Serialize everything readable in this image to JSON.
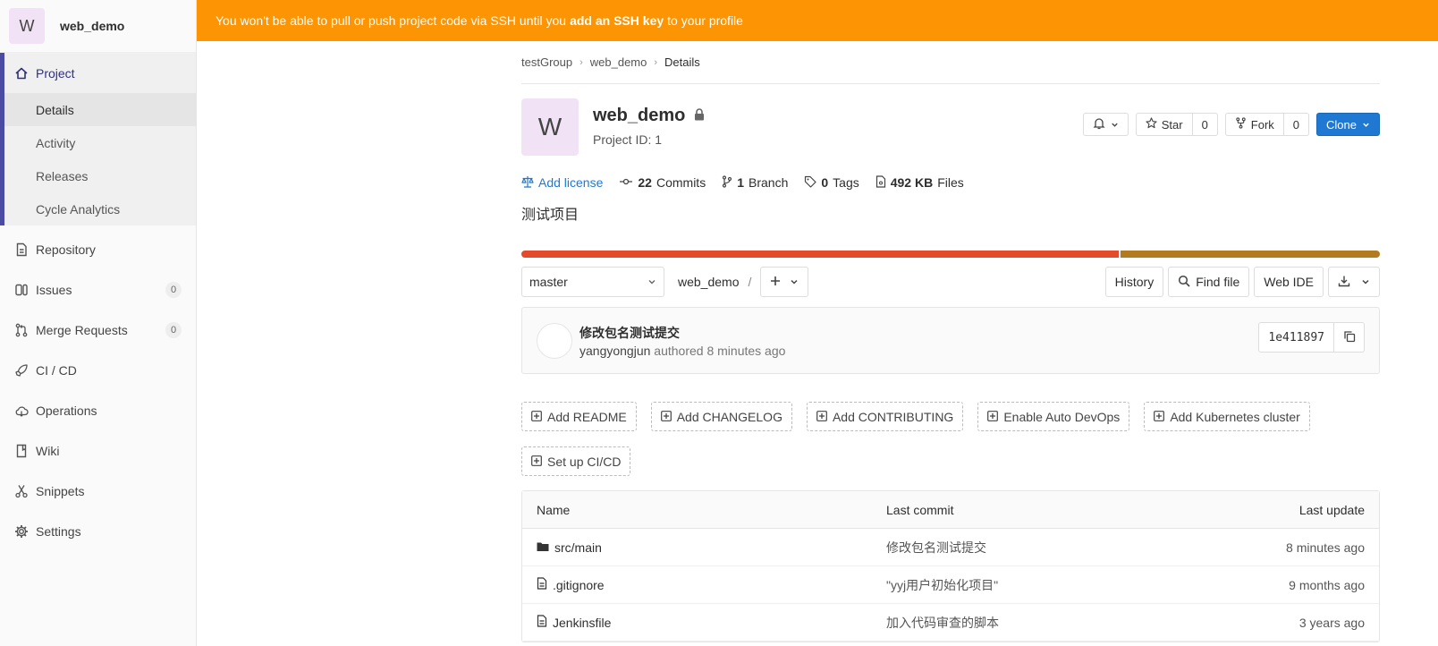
{
  "sidebar": {
    "avatar_letter": "W",
    "project_name": "web_demo",
    "project_section": {
      "label": "Project",
      "items": [
        "Details",
        "Activity",
        "Releases",
        "Cycle Analytics"
      ]
    },
    "items": [
      {
        "label": "Repository",
        "icon": "document-icon"
      },
      {
        "label": "Issues",
        "icon": "issues-icon",
        "count": "0"
      },
      {
        "label": "Merge Requests",
        "icon": "merge-request-icon",
        "count": "0"
      },
      {
        "label": "CI / CD",
        "icon": "rocket-icon"
      },
      {
        "label": "Operations",
        "icon": "cloud-icon"
      },
      {
        "label": "Wiki",
        "icon": "book-icon"
      },
      {
        "label": "Snippets",
        "icon": "scissors-icon"
      },
      {
        "label": "Settings",
        "icon": "gear-icon"
      }
    ]
  },
  "banner": {
    "prefix": "You won't be able to pull or push project code via SSH until you",
    "link": "add an SSH key",
    "suffix": "to your profile"
  },
  "breadcrumb": [
    "testGroup",
    "web_demo",
    "Details"
  ],
  "project": {
    "avatar_letter": "W",
    "title": "web_demo",
    "id_label": "Project ID: 1",
    "description": "测试项目"
  },
  "actions": {
    "star_label": "Star",
    "star_count": "0",
    "fork_label": "Fork",
    "fork_count": "0",
    "clone_label": "Clone"
  },
  "stats": {
    "license": "Add license",
    "commits_num": "22",
    "commits_label": "Commits",
    "branch_num": "1",
    "branch_label": "Branch",
    "tags_num": "0",
    "tags_label": "Tags",
    "files_size": "492 KB",
    "files_label": "Files"
  },
  "languages": [
    {
      "fraction": 0.697,
      "color": "#e44b2b"
    },
    {
      "fraction": 0.303,
      "color": "#b27b20"
    }
  ],
  "toolbar": {
    "branch": "master",
    "path": "web_demo",
    "separator": "/",
    "history": "History",
    "find_file": "Find file",
    "web_ide": "Web IDE"
  },
  "commit": {
    "title": "修改包名测试提交",
    "author": "yangyongjun",
    "meta": "authored 8 minutes ago",
    "sha": "1e411897"
  },
  "add_buttons": [
    "Add README",
    "Add CHANGELOG",
    "Add CONTRIBUTING",
    "Enable Auto DevOps",
    "Add Kubernetes cluster",
    "Set up CI/CD"
  ],
  "files": {
    "headers": {
      "name": "Name",
      "last_commit": "Last commit",
      "last_update": "Last update"
    },
    "rows": [
      {
        "type": "folder",
        "name": "src/main",
        "commit": "修改包名测试提交",
        "updated": "8 minutes ago"
      },
      {
        "type": "file",
        "name": ".gitignore",
        "commit": "\"yyj用户初始化项目\"",
        "updated": "9 months ago"
      },
      {
        "type": "file",
        "name": "Jenkinsfile",
        "commit": "加入代码审查的脚本",
        "updated": "3 years ago"
      }
    ]
  }
}
